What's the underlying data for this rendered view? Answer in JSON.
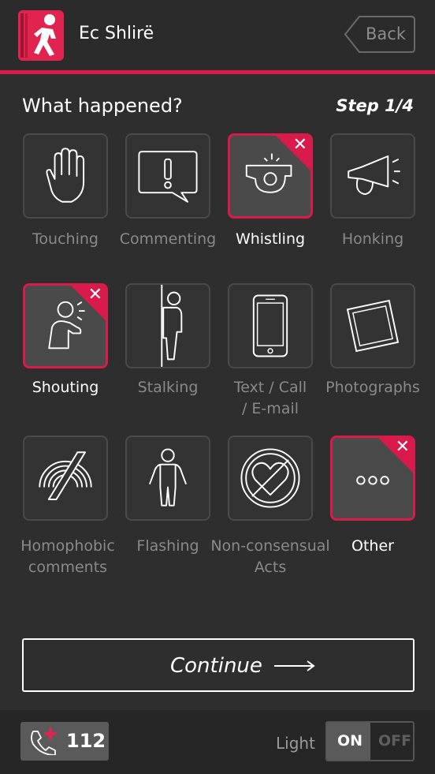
{
  "header": {
    "title": "Ec Shlirë",
    "back_label": "Back"
  },
  "question": "What happened?",
  "step": "Step 1/4",
  "options": [
    {
      "label": "Touching",
      "selected": false,
      "icon": "hand-icon"
    },
    {
      "label": "Commenting",
      "selected": false,
      "icon": "speech-exclamation-icon"
    },
    {
      "label": "Whistling",
      "selected": true,
      "icon": "whistle-icon"
    },
    {
      "label": "Honking",
      "selected": false,
      "icon": "horn-icon"
    },
    {
      "label": "Shouting",
      "selected": true,
      "icon": "shouting-person-icon"
    },
    {
      "label": "Stalking",
      "selected": false,
      "icon": "stalker-icon"
    },
    {
      "label": "Text / Call / E-mail",
      "selected": false,
      "icon": "phone-icon"
    },
    {
      "label": "Photographs",
      "selected": false,
      "icon": "photo-icon"
    },
    {
      "label": "Homophobic comments",
      "selected": false,
      "icon": "crossed-rainbow-icon"
    },
    {
      "label": "Flashing",
      "selected": false,
      "icon": "person-icon"
    },
    {
      "label": "Non-consensual Acts",
      "selected": false,
      "icon": "crossed-heart-icon"
    },
    {
      "label": "Other",
      "selected": true,
      "icon": "ellipsis-icon"
    }
  ],
  "deselect_glyph": "✕",
  "continue_label": "Continue",
  "footer": {
    "emergency_number": "112",
    "light_label": "Light",
    "toggle_on": "ON",
    "toggle_off": "OFF"
  },
  "colors": {
    "accent": "#d81b4a",
    "background": "#2e2e2e",
    "tile_selected": "#4a4a4a"
  }
}
